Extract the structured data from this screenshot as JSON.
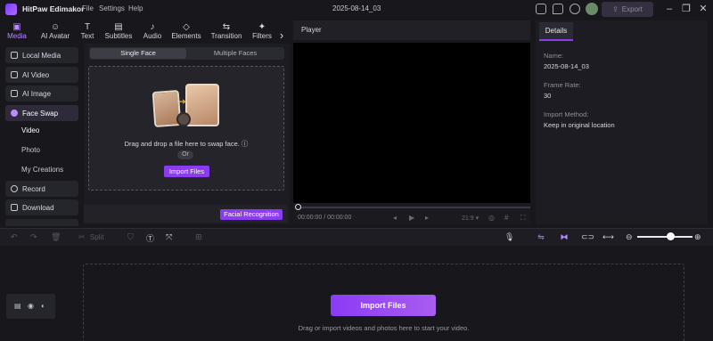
{
  "app": {
    "title": "HitPaw Edimakor",
    "project_name": "2025-08-14_03"
  },
  "menu": {
    "file": "File",
    "settings": "Settings",
    "help": "Help"
  },
  "header": {
    "export_label": "Export"
  },
  "tool_tabs": [
    {
      "label": "Media",
      "icon": "media-icon",
      "active": true
    },
    {
      "label": "AI Avatar",
      "icon": "ai-avatar-icon",
      "active": false
    },
    {
      "label": "Text",
      "icon": "text-icon",
      "active": false
    },
    {
      "label": "Subtitles",
      "icon": "subtitles-icon",
      "active": false
    },
    {
      "label": "Audio",
      "icon": "audio-icon",
      "active": false
    },
    {
      "label": "Elements",
      "icon": "elements-icon",
      "active": false
    },
    {
      "label": "Transition",
      "icon": "transition-icon",
      "active": false
    },
    {
      "label": "Filters",
      "icon": "filters-icon",
      "active": false
    }
  ],
  "sidebar": {
    "items": [
      {
        "label": "Local Media"
      },
      {
        "label": "AI Video"
      },
      {
        "label": "AI Image"
      },
      {
        "label": "Face Swap",
        "active": true
      },
      {
        "label": "Record"
      },
      {
        "label": "Download"
      }
    ],
    "sub_items": [
      {
        "label": "Video",
        "active": true
      },
      {
        "label": "Photo"
      },
      {
        "label": "My Creations"
      }
    ]
  },
  "face_swap": {
    "tab_single": "Single Face",
    "tab_multiple": "Multiple Faces",
    "drop_text": "Drag and drop a file here to swap face. ⓘ",
    "or_label": "Or",
    "import_label": "Import Files",
    "facial_recognition_label": "Facial Recognition"
  },
  "player": {
    "title": "Player",
    "time": "00:00:00 / 00:00:00",
    "aspect": "21:9"
  },
  "details": {
    "tab_label": "Details",
    "name_label": "Name:",
    "name_value": "2025-08-14_03",
    "frame_rate_label": "Frame Rate:",
    "frame_rate_value": "30",
    "import_method_label": "Import Method:",
    "import_method_value": "Keep in original location"
  },
  "timeline": {
    "split_label": "Split",
    "zoom_level": 0.6,
    "import_label": "Import Files",
    "hint": "Drag or import videos and photos here to start your video."
  },
  "colors": {
    "accent": "#8c3cf0",
    "accent_light": "#b98bff",
    "background": "#17171c"
  }
}
